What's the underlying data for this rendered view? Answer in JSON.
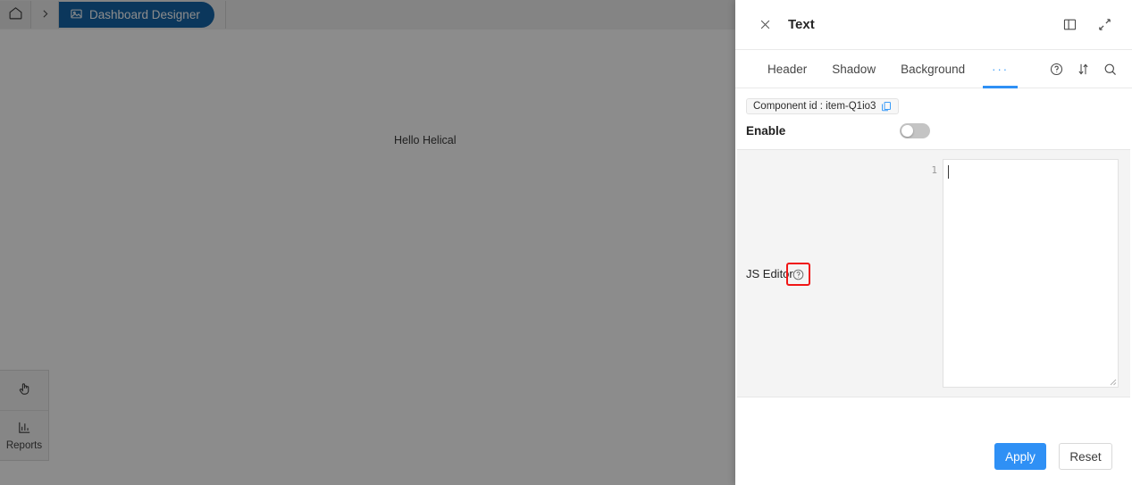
{
  "background_app": {
    "breadcrumb": {
      "home_icon": "home-icon",
      "separator": "chevron-right-icon",
      "active_label": "Dashboard Designer",
      "active_icon": "image-icon"
    },
    "canvas": {
      "text_widget": "Hello Helical"
    },
    "left_dock": {
      "items": [
        {
          "icon": "pointer-hand-icon",
          "label": ""
        },
        {
          "icon": "bar-chart-icon",
          "label": "Reports"
        }
      ]
    }
  },
  "panel": {
    "header": {
      "close_icon": "close-icon",
      "title": "Text",
      "layout_icon": "panel-layout-icon",
      "expand_icon": "expand-diagonal-icon"
    },
    "tabs": [
      {
        "label": "Header",
        "active": false
      },
      {
        "label": "Shadow",
        "active": false
      },
      {
        "label": "Background",
        "active": false
      },
      {
        "label": "···",
        "active": true
      }
    ],
    "tab_icons": [
      {
        "name": "help-circle-icon"
      },
      {
        "name": "sort-arrows-icon"
      },
      {
        "name": "search-icon"
      }
    ],
    "component_id": {
      "text": "Component id : item-Q1io3",
      "copy_icon": "copy-icon"
    },
    "enable": {
      "label": "Enable",
      "state": "off"
    },
    "js_editor": {
      "label": "JS Editor",
      "help_icon": "help-circle-icon",
      "help_icon_highlighted": true,
      "highlight_color": "#f01616",
      "line_numbers": [
        "1"
      ],
      "code_value": "",
      "resize_grip_icon": "resize-grip-icon"
    },
    "footer": {
      "apply_label": "Apply",
      "reset_label": "Reset",
      "apply_color": "#2f90f5"
    }
  }
}
